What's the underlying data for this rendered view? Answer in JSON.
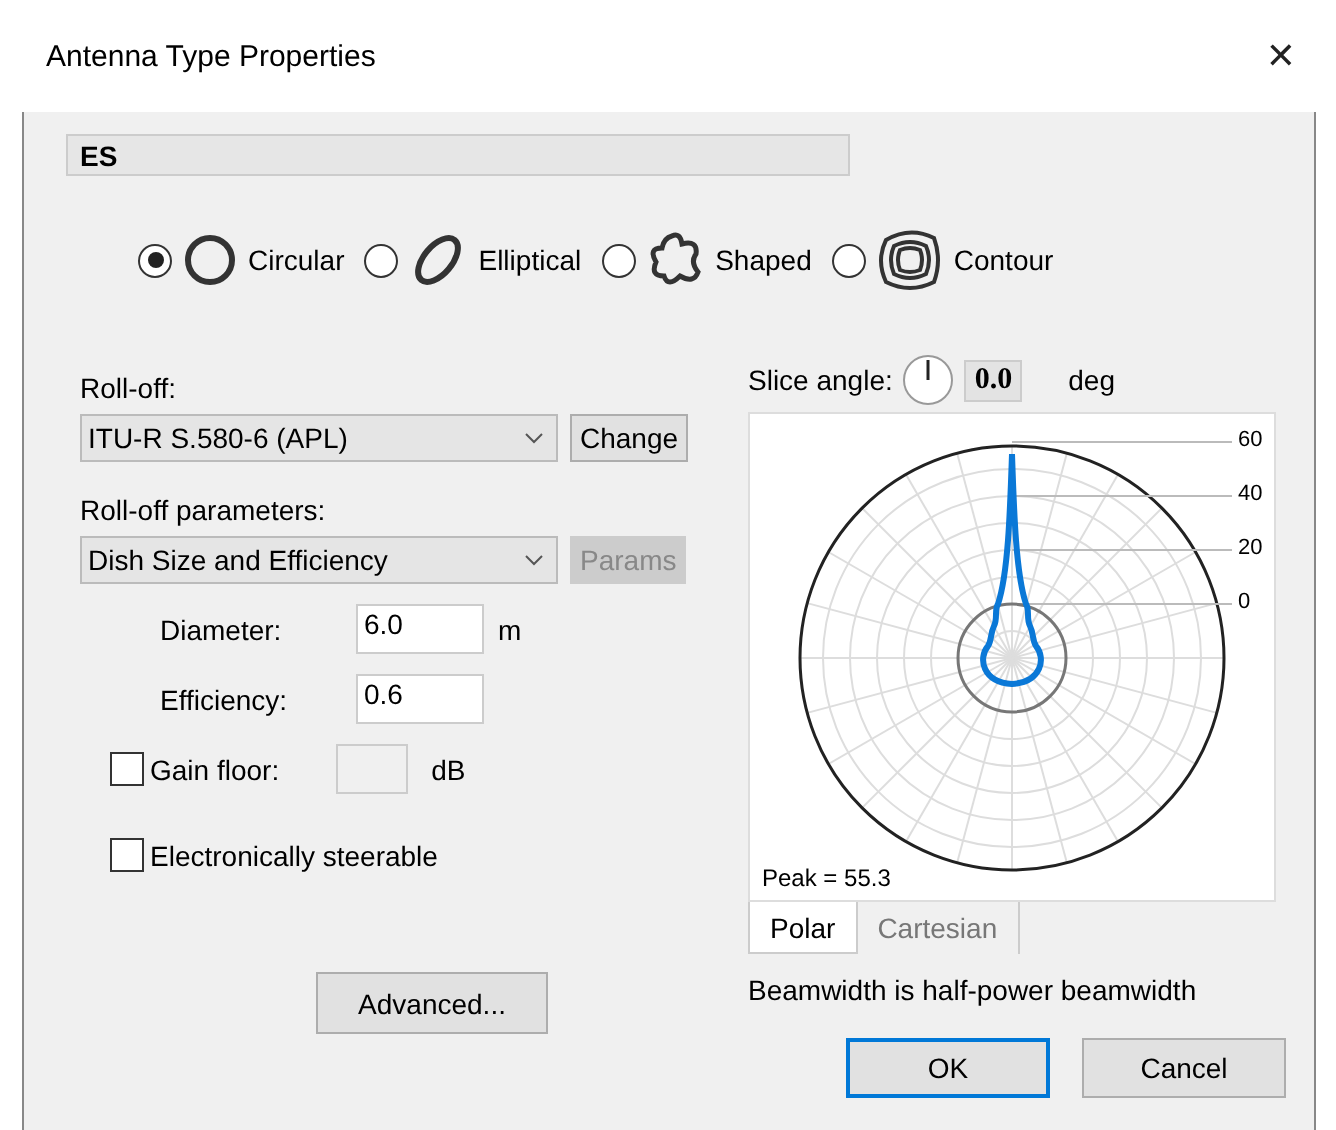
{
  "window": {
    "title": "Antenna Type Properties",
    "close": "✕"
  },
  "name_field": {
    "value": "ES"
  },
  "antenna_types": [
    {
      "label": "Circular",
      "kind": "circle",
      "selected": true
    },
    {
      "label": "Elliptical",
      "kind": "ellipse",
      "selected": false
    },
    {
      "label": "Shaped",
      "kind": "star",
      "selected": false
    },
    {
      "label": "Contour",
      "kind": "contour",
      "selected": false
    }
  ],
  "rolloff": {
    "label": "Roll-off:",
    "value": "ITU-R S.580-6 (APL)",
    "button": {
      "label": "Change",
      "disabled": false
    }
  },
  "rolloff_parameters": {
    "label": "Roll-off parameters:",
    "value": "Dish Size and Efficiency",
    "button": {
      "label": "Params",
      "disabled": true
    }
  },
  "parameters": [
    {
      "label": "Diameter:",
      "value": "6.0",
      "unit": "m"
    },
    {
      "label": "Efficiency:",
      "value": "0.6"
    }
  ],
  "gain_floor": {
    "label": "Gain floor:",
    "checked": false,
    "unit": "dB"
  },
  "electronically_steerable": {
    "label": "Electronically steerable",
    "checked": false
  },
  "advanced_button": "Advanced...",
  "slice_angle": {
    "label": "Slice angle:",
    "value": "0.0",
    "unit": "deg"
  },
  "plot": {
    "ring_labels": [
      "60",
      "40",
      "20",
      "0"
    ],
    "peak": "Peak = 55.3"
  },
  "plot_tabs": [
    {
      "label": "Polar",
      "selected": true
    },
    {
      "label": "Cartesian",
      "selected": false
    }
  ],
  "note": "Beamwidth is half-power beamwidth",
  "buttons": [
    {
      "label": "OK",
      "default": true
    },
    {
      "label": "Cancel",
      "default": false
    }
  ]
}
